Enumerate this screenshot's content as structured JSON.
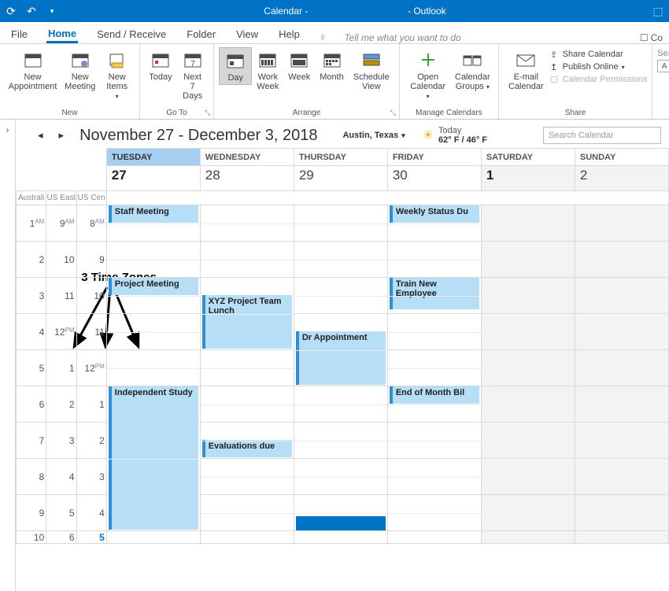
{
  "titlebar": {
    "title_left": "Calendar -",
    "title_right": "- Outlook"
  },
  "menu": {
    "file": "File",
    "home": "Home",
    "sendreceive": "Send / Receive",
    "folder": "Folder",
    "view": "View",
    "help": "Help",
    "tellme": "Tell me what you want to do",
    "co": "Co"
  },
  "ribbon": {
    "new": {
      "group": "New",
      "appointment": "New\nAppointment",
      "meeting": "New\nMeeting",
      "items": "New\nItems"
    },
    "goto": {
      "group": "Go To",
      "today": "Today",
      "next7": "Next 7\nDays"
    },
    "arrange": {
      "group": "Arrange",
      "day": "Day",
      "workweek": "Work\nWeek",
      "week": "Week",
      "month": "Month",
      "scheduleview": "Schedule\nView"
    },
    "manage": {
      "group": "Manage Calendars",
      "opencal": "Open\nCalendar",
      "calgroups": "Calendar\nGroups"
    },
    "share": {
      "group": "Share",
      "email": "E-mail\nCalendar",
      "sharecal": "Share Calendar",
      "publish": "Publish Online",
      "perms": "Calendar Permissions"
    },
    "searchgroup": "Sear"
  },
  "head": {
    "range": "November 27 - December 3, 2018",
    "loc": "Austin, Texas",
    "today_lbl": "Today",
    "temps": "62° F / 46° F",
    "search_ph": "Search Calendar"
  },
  "annotation": "3 Time Zones",
  "tz": {
    "c1": "Australi",
    "c2": "US East",
    "c3": "US Cen"
  },
  "days": {
    "tue": "TUESDAY",
    "wed": "WEDNESDAY",
    "thu": "THURSDAY",
    "fri": "FRIDAY",
    "sat": "SATURDAY",
    "sun": "SUNDAY",
    "d27": "27",
    "d28": "28",
    "d29": "29",
    "d30": "30",
    "d1": "1",
    "d2": "2"
  },
  "hours": {
    "r1": {
      "a": "1",
      "aap": "AM",
      "b": "9",
      "bap": "AM",
      "c": "8",
      "cap": "AM"
    },
    "r2": {
      "a": "2",
      "b": "10",
      "c": "9"
    },
    "r3": {
      "a": "3",
      "b": "11",
      "c": "10"
    },
    "r4": {
      "a": "4",
      "b": "12",
      "bap": "PM",
      "c": "11"
    },
    "r5": {
      "a": "5",
      "b": "1",
      "c": "12",
      "cap": "PM"
    },
    "r6": {
      "a": "6",
      "b": "2",
      "c": "1"
    },
    "r7": {
      "a": "7",
      "b": "3",
      "c": "2"
    },
    "r8": {
      "a": "8",
      "b": "4",
      "c": "3"
    },
    "r9": {
      "a": "9",
      "b": "5",
      "c": "4"
    },
    "r10": {
      "a": "10",
      "b": "6",
      "c": "5"
    }
  },
  "events": {
    "staff": "Staff Meeting",
    "project": "Project Meeting",
    "xyz": "XYZ Project Team Lunch",
    "eval": "Evaluations due",
    "dr": "Dr Appointment",
    "weekly": "Weekly Status Du",
    "train": "Train New Employee",
    "eom": "End of Month Bil",
    "ind": "Independent Study"
  },
  "icons": {
    "refresh": "⟳",
    "undo": "↶",
    "down": "▾",
    "winmax": "⬚",
    "bulb": "💡",
    "chevr": "›",
    "chevl": "‹",
    "plus": "+",
    "arrowr": "▸",
    "arrowl": "◂"
  }
}
